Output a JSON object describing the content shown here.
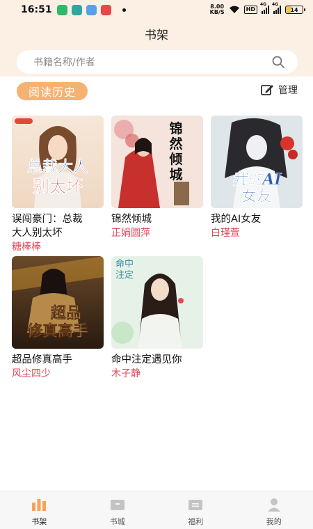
{
  "status_bar": {
    "time": "16:51",
    "net_speed_value": "8.00",
    "net_speed_unit": "KB/S",
    "hd": "HD",
    "signal_1": "4G",
    "signal_2": "4G",
    "battery": "14"
  },
  "header": {
    "title": "书架"
  },
  "search": {
    "placeholder": "书籍名称/作者"
  },
  "history_button": "阅读历史",
  "manage_label": "管理",
  "books": [
    {
      "title_line1": "误闯豪门：总裁",
      "title_line2": "大人别太坏",
      "author": "糖棒棒",
      "cover_text_1": "总裁大人",
      "cover_text_2": "别太坏"
    },
    {
      "title_line1": "锦然倾城",
      "author": "正娟圆萍",
      "cover_text": "锦然倾城"
    },
    {
      "title_line1": "我的AI女友",
      "author": "白瑾萱",
      "cover_text_1": "我的AI",
      "cover_text_2": "女友"
    },
    {
      "title_line1": "超品修真高手",
      "author": "风尘四少",
      "cover_text_1": "超品",
      "cover_text_2": "修真高手"
    },
    {
      "title_line1": "命中注定遇见你",
      "author": "木子静",
      "cover_text": "命中注定"
    }
  ],
  "tabs": [
    {
      "label": "书架",
      "icon": "bookshelf-icon",
      "active": true
    },
    {
      "label": "书城",
      "icon": "bookstore-icon",
      "active": false
    },
    {
      "label": "福利",
      "icon": "welfare-icon",
      "active": false
    },
    {
      "label": "我的",
      "icon": "profile-icon",
      "active": false
    }
  ],
  "colors": {
    "header_bg": "#fcefe3",
    "accent": "#f6b272",
    "author_red": "#e04a5a"
  }
}
